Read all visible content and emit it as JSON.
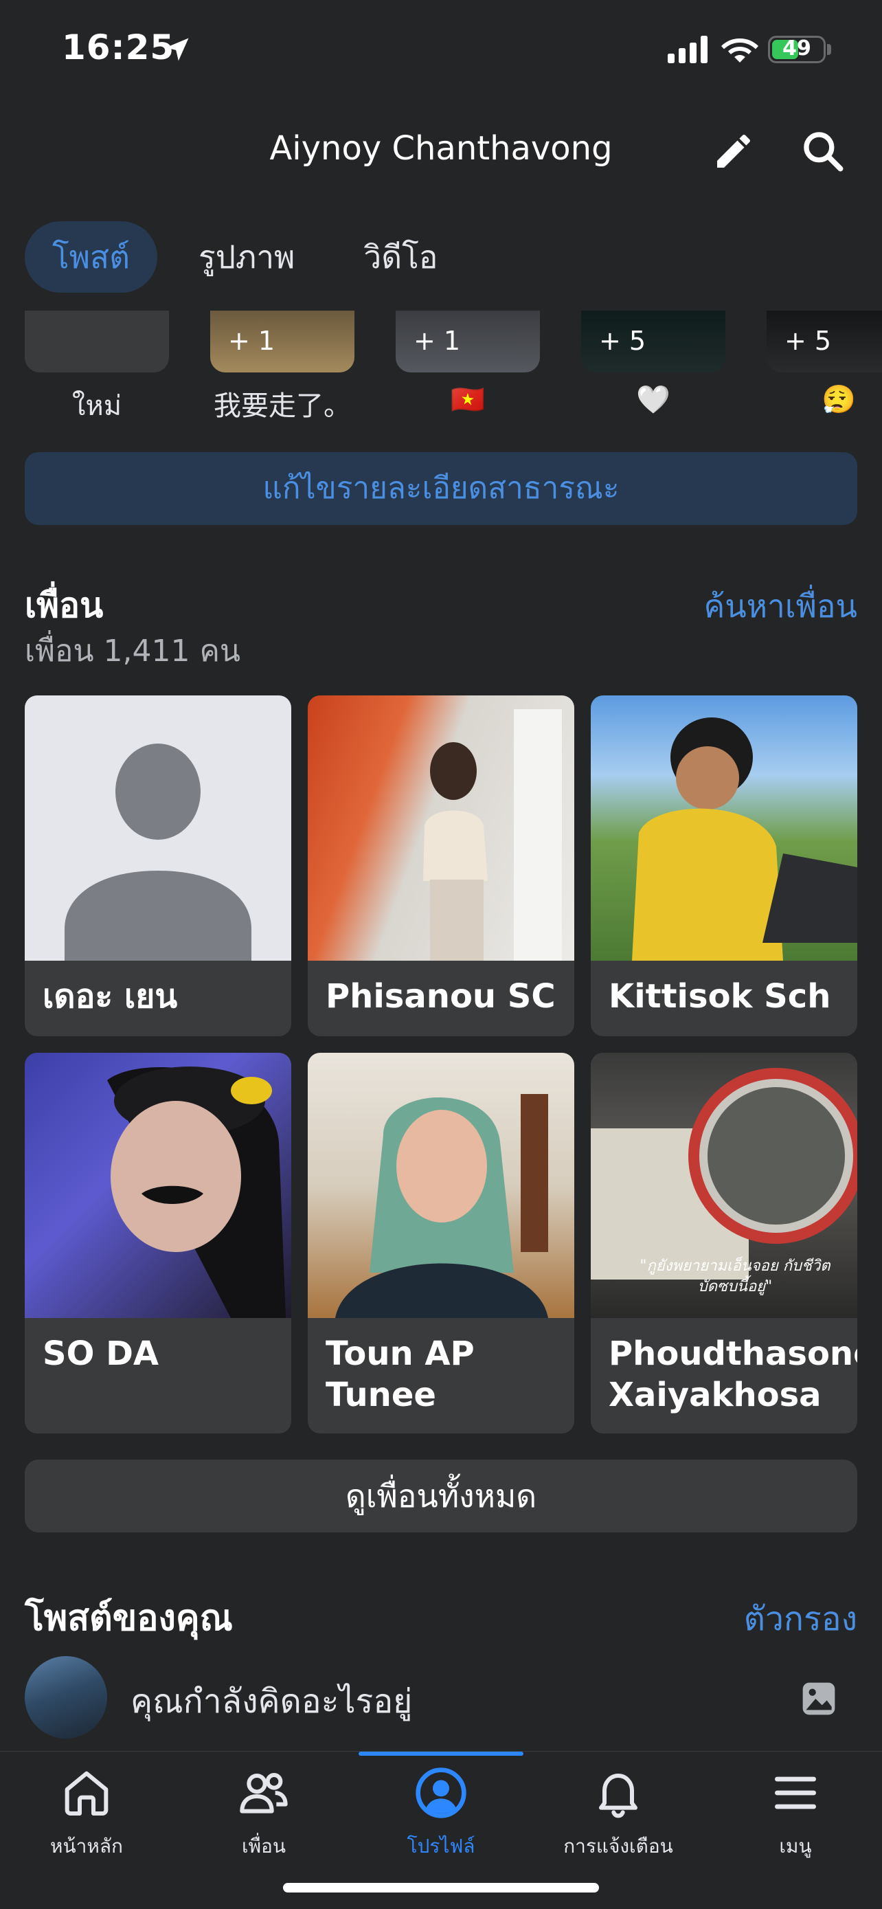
{
  "status_bar": {
    "time": "16:25",
    "battery": "49"
  },
  "header": {
    "title": "Aiynoy Chanthavong"
  },
  "tabs": [
    {
      "label": "โพสต์",
      "active": true
    },
    {
      "label": "รูปภาพ",
      "active": false
    },
    {
      "label": "วิดีโอ",
      "active": false
    }
  ],
  "highlights": [
    {
      "label": "ใหม่",
      "count": ""
    },
    {
      "label": "我要走了。",
      "count": "+ 1"
    },
    {
      "label": "🇻🇳",
      "count": "+ 1"
    },
    {
      "label": "🤍",
      "count": "+ 5"
    },
    {
      "label": "😮‍💨",
      "count": "+ 5"
    }
  ],
  "edit_public_label": "แก้ไขรายละเอียดสาธารณะ",
  "friends": {
    "heading": "เพื่อน",
    "count_text": "เพื่อน 1,411 คน",
    "find_label": "ค้นหาเพื่อน",
    "items": [
      {
        "name": "เดอะ เยน"
      },
      {
        "name": "Phisanou SC"
      },
      {
        "name": "Kittisok Sch"
      },
      {
        "name": "SO DA"
      },
      {
        "name": "Toun AP Tunee"
      },
      {
        "name": "Phoudthasone Xaiyakhosa"
      }
    ],
    "photo_caption": "\"กูยังพยายามเอ็นจอย กับชีวิตบัดซบนี้อยู่\"",
    "see_all_label": "ดูเพื่อนทั้งหมด"
  },
  "posts": {
    "heading": "โพสต์ของคุณ",
    "filter_label": "ตัวกรอง",
    "composer_placeholder": "คุณกำลังคิดอะไรอยู่"
  },
  "nav": [
    {
      "label": "หน้าหลัก",
      "icon": "home-icon",
      "active": false
    },
    {
      "label": "เพื่อน",
      "icon": "friends-icon",
      "active": false
    },
    {
      "label": "โปรไฟล์",
      "icon": "profile-icon",
      "active": true
    },
    {
      "label": "การแจ้งเตือน",
      "icon": "bell-icon",
      "active": false
    },
    {
      "label": "เมนู",
      "icon": "menu-icon",
      "active": false
    }
  ],
  "colors": {
    "accent": "#2d88ff",
    "link": "#4b8fe2",
    "background": "#242526",
    "card": "#3a3b3c"
  }
}
